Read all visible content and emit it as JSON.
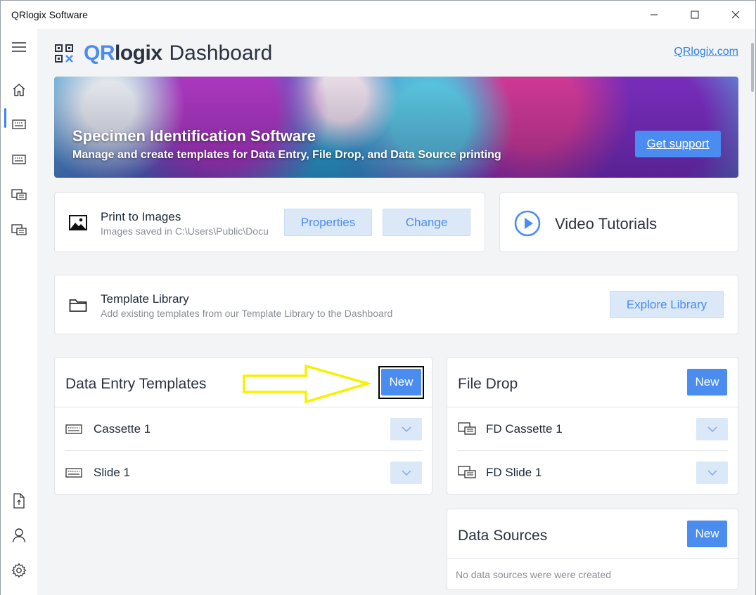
{
  "window": {
    "title": "QRlogix Software"
  },
  "header": {
    "logo_qr": "QR",
    "logo_rest": "logix",
    "page_title": "Dashboard",
    "site_link": "QRlogix.com"
  },
  "banner": {
    "title": "Specimen Identification Software",
    "subtitle": "Manage and create templates for Data Entry, File Drop, and Data Source printing",
    "support_label": "Get support"
  },
  "printer": {
    "title": "Print to Images",
    "subtitle": "Images saved in C:\\Users\\Public\\Docu",
    "properties_label": "Properties",
    "change_label": "Change"
  },
  "tutorials": {
    "title": "Video Tutorials"
  },
  "library": {
    "title": "Template Library",
    "subtitle": "Add existing templates from our Template Library to the Dashboard",
    "explore_label": "Explore Library"
  },
  "data_entry": {
    "title": "Data Entry Templates",
    "new_label": "New",
    "items": [
      {
        "label": "Cassette 1"
      },
      {
        "label": "Slide 1"
      }
    ]
  },
  "file_drop": {
    "title": "File Drop",
    "new_label": "New",
    "items": [
      {
        "label": "FD Cassette 1"
      },
      {
        "label": "FD Slide 1"
      }
    ]
  },
  "data_sources": {
    "title": "Data Sources",
    "new_label": "New",
    "empty_text": "No data sources were were created"
  },
  "colors": {
    "accent": "#4a8cf0",
    "light_button": "#dbe8f8",
    "annotation_arrow": "#f5f200"
  }
}
